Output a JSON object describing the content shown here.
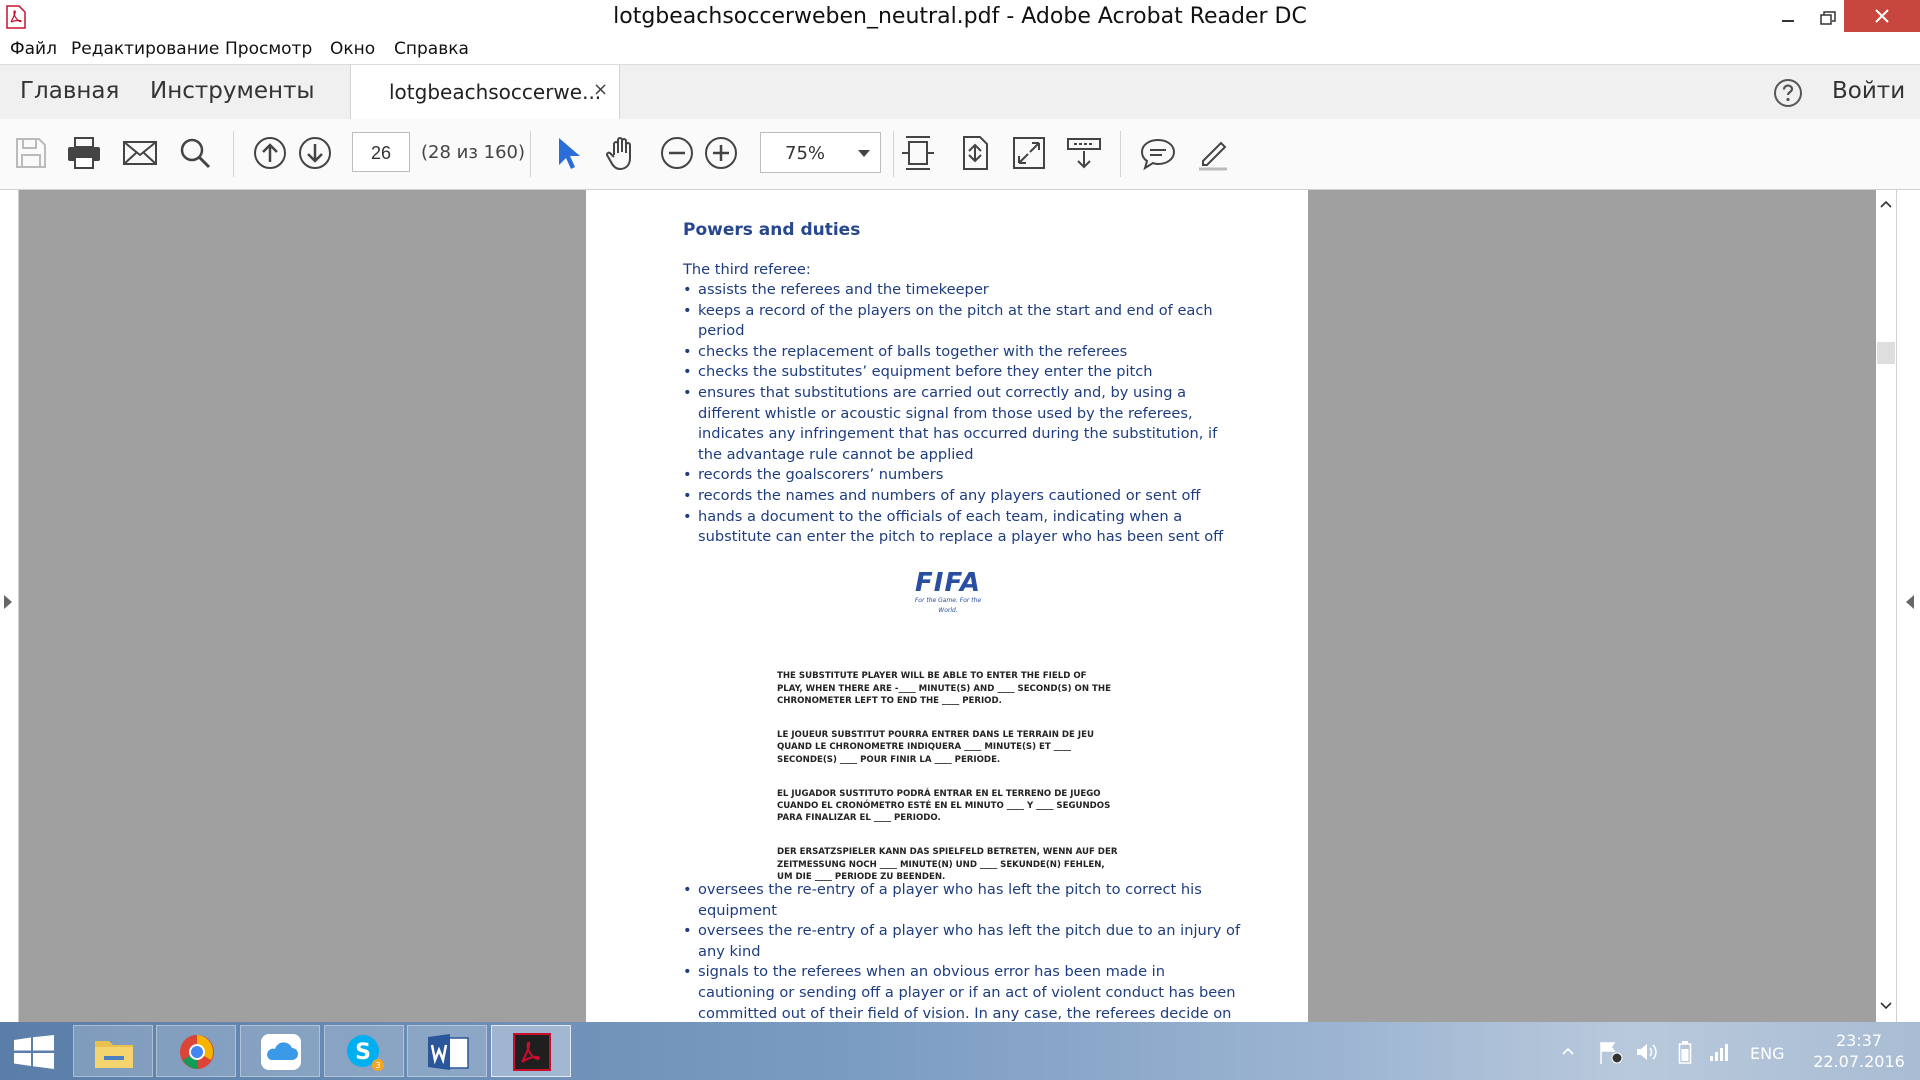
{
  "window": {
    "title": "lotgbeachsoccerweben_neutral.pdf - Adobe Acrobat Reader DC"
  },
  "menu": [
    "Файл",
    "Редактирование",
    "Просмотр",
    "Окно",
    "Справка"
  ],
  "tabs": {
    "home": "Главная",
    "tools": "Инструменты",
    "document": "lotgbeachsoccerwe...",
    "close": "×",
    "signin": "Войти"
  },
  "toolbar": {
    "page_current": "26",
    "page_count": "(28 из 160)",
    "zoom": "75%"
  },
  "document": {
    "section_title": "Powers and duties",
    "intro": "The third referee:",
    "bullets": [
      "assists the referees and the timekeeper",
      "keeps a record of the players on the pitch at the start and end of each period",
      "checks the replacement of balls together with the referees",
      "checks the substitutes’ equipment before they enter the pitch",
      "ensures that substitutions are carried out correctly and, by using a different whistle or acoustic signal from those used by the referees, indicates any infringement that has occurred during the substitution, if the advantage rule cannot be applied",
      "records the goalscorers’ numbers",
      "records the names and numbers of any players cautioned or sent off",
      "hands a document to the officials of each team, indicating when a substitute can enter the pitch to replace a player who has been sent off"
    ],
    "fifa_logo": "FIFA",
    "fifa_tagline": "For the Game. For the World.",
    "notice": [
      "THE SUBSTITUTE PLAYER WILL BE ABLE TO ENTER THE FIELD OF\nPLAY, WHEN THERE ARE -____ MINUTE(S) AND ____ SECOND(S) ON THE\nCHRONOMETER LEFT TO END THE ____ PERIOD.",
      "LE JOUEUR SUBSTITUT POURRA ENTRER DANS LE TERRAIN DE JEU\nQUAND LE CHRONOMETRE INDIQUERA ____ MINUTE(S) ET ____\nSECONDE(S) ____ POUR FINIR LA ____ PERIODE.",
      "EL JUGADOR SUSTITUTO PODRÁ ENTRAR EN EL TERRENO DE JUEGO\nCUANDO EL CRONÓMETRO ESTÉ EN EL MINUTO ____ Y  ____ SEGUNDOS\nPARA FINALIZAR EL ____ PERIODO.",
      "DER ERSATZSPIELER KANN DAS SPIELFELD BETRETEN, WENN AUF DER\nZEITMESSUNG NOCH ____ MINUTE(N) UND ____ SEKUNDE(N) FEHLEN,\nUM DIE ____ PERIODE ZU BEENDEN."
    ],
    "bullets_after": [
      "oversees the re-entry of a player who has left the pitch to correct his equipment",
      "oversees the re-entry of a player who has left the pitch due to an injury of any kind",
      "signals to the referees when an obvious error has been made in cautioning or sending off a player or if an act of violent conduct has been committed out of their field of vision. In any case, the referees decide on any facts"
    ]
  },
  "taskbar": {
    "language": "ENG",
    "time": "23:37",
    "date": "22.07.2016",
    "skype_badge": "3"
  },
  "colors": {
    "doc_text": "#1e3d7f",
    "close_button": "#c7463e",
    "acrobat_red": "#c8102e"
  },
  "icons": [
    "save-icon",
    "print-icon",
    "email-icon",
    "search-icon",
    "page-up-icon",
    "page-down-icon",
    "select-cursor-icon",
    "hand-icon",
    "zoom-out-icon",
    "zoom-in-icon",
    "fit-page-icon",
    "rotate-page-icon",
    "fullscreen-icon",
    "scroll-mode-icon",
    "comment-icon",
    "highlight-icon",
    "help-icon"
  ]
}
